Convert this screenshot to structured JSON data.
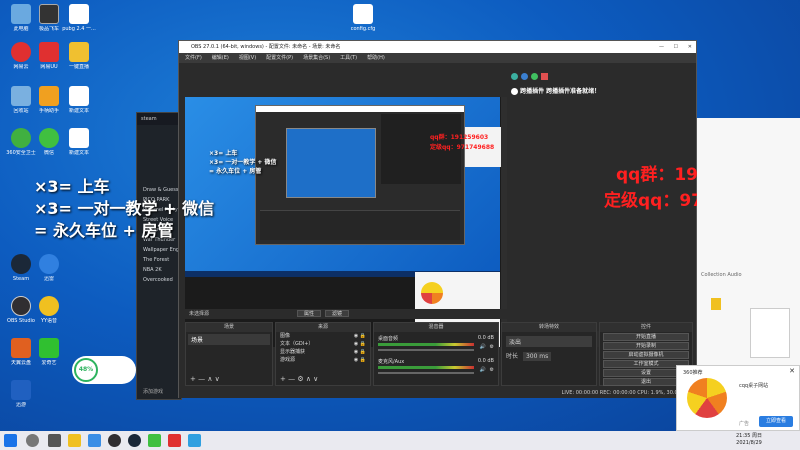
{
  "desktop": {
    "icons": [
      {
        "label": "此电脑",
        "color": "#6aa9e0"
      },
      {
        "label": "极品飞车",
        "color": "#333"
      },
      {
        "label": "pubg 2.4 一...",
        "color": "#fff"
      },
      {
        "label": "网易云",
        "color": "#e03030"
      },
      {
        "label": "网易UU",
        "color": "#e03030"
      },
      {
        "label": "一键直播",
        "color": "#f0c030"
      },
      {
        "label": "回收站",
        "color": "#7ab0e0"
      },
      {
        "label": "手柄助手",
        "color": "#f0a020"
      },
      {
        "label": "新建文本",
        "color": "#fff"
      },
      {
        "label": "360安全卫士",
        "color": "#40b040"
      },
      {
        "label": "微信",
        "color": "#40c040"
      },
      {
        "label": "新建文本",
        "color": "#fff"
      },
      {
        "label": "Steam",
        "color": "#1b2838"
      },
      {
        "label": "迅雷",
        "color": "#3080e0"
      },
      {
        "label": "OBS Studio",
        "color": "#302e31"
      },
      {
        "label": "YY语音",
        "color": "#f0c020"
      },
      {
        "label": "天翼云盘",
        "color": "#e06020"
      },
      {
        "label": "爱奇艺",
        "color": "#30c030"
      },
      {
        "label": "迅游",
        "color": "#2060c0"
      }
    ],
    "top_file": "config.cfg",
    "left_file": "config.cfg"
  },
  "overlay": {
    "line1": "×3= 上车",
    "line2": "×3= 一对一教学 + 微信",
    "line3": "= 永久车位 + 房管",
    "qq_group": "qq群：191259603",
    "rank_qq": "定级qq：971749688"
  },
  "obs": {
    "title": "OBS 27.0.1 (64-bit, windows) - 配置文件: 未命名 - 场景: 未命名",
    "menu": [
      "文件(F)",
      "编辑(E)",
      "视图(V)",
      "配置文件(P)",
      "场景集合(S)",
      "工具(T)",
      "帮助(H)"
    ],
    "plugin_notice": "跨播插件 跨播插件准备就绪！",
    "no_source": "未选择源",
    "props_button": "属性",
    "filters_button": "滤镜",
    "panels": {
      "scenes": "场景",
      "sources": "来源",
      "mixer": "混音器",
      "transitions": "转场特效",
      "controls": "控件"
    },
    "scene_item": "场景",
    "sources_list": [
      "图像",
      "文本（GDI+）",
      "显示器捕获",
      "游戏源"
    ],
    "mixer": [
      {
        "name": "桌面音频",
        "level": "0.0 dB"
      },
      {
        "name": "麦克风/Aux",
        "level": "0.0 dB"
      }
    ],
    "transition": {
      "type_label": "淡出",
      "duration_label": "时长",
      "duration": "300 ms"
    },
    "controls": [
      "开始直播",
      "开始录制",
      "启动虚拟摄像机",
      "工作室模式",
      "设置",
      "退出"
    ],
    "status": "LIVE: 00:00:00   REC: 00:00:00   CPU: 1.9%, 30.00 fps"
  },
  "side_window": {
    "title": "steam",
    "items": [
      "Draw & Guess",
      "PICO PARK",
      "Pummel Party",
      "Street Voice",
      "Unturned",
      "War Thunder",
      "Wallpaper Engine",
      "The Forest",
      "NBA 2K",
      "Overcooked"
    ],
    "footer": "添加游戏"
  },
  "battery_widget": {
    "value": "48%"
  },
  "popup_360": {
    "title": "360推荐",
    "link": "cqq桌子网站",
    "button": "立即查看",
    "ad": "广告"
  },
  "right_panel": {
    "title": "Collection Audio"
  },
  "clock": {
    "time": "21:35 周日",
    "date": "2021/8/29"
  }
}
